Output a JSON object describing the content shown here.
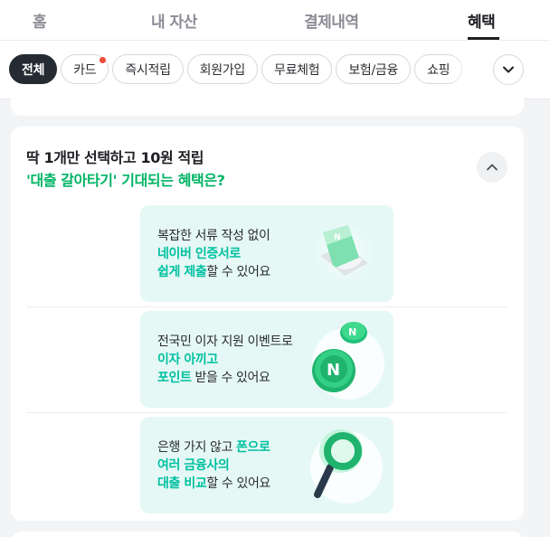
{
  "top_tabs": [
    {
      "label": "홈",
      "active": false
    },
    {
      "label": "내 자산",
      "active": false
    },
    {
      "label": "결제내역",
      "active": false
    },
    {
      "label": "혜택",
      "active": true
    }
  ],
  "chips": [
    {
      "label": "전체",
      "active": true,
      "new_dot": false
    },
    {
      "label": "카드",
      "active": false,
      "new_dot": true
    },
    {
      "label": "즉시적립",
      "active": false,
      "new_dot": false
    },
    {
      "label": "회원가입",
      "active": false,
      "new_dot": false
    },
    {
      "label": "무료체험",
      "active": false,
      "new_dot": false
    },
    {
      "label": "보험/금융",
      "active": false,
      "new_dot": false
    },
    {
      "label": "쇼핑",
      "active": false,
      "new_dot": false
    }
  ],
  "card": {
    "title": "딱 1개만 선택하고 10원 적립",
    "subtitle": "'대출 갈아타기' 기대되는 혜택은?",
    "benefits": [
      {
        "lines": [
          [
            {
              "t": "복잡한 서류 작성 없이",
              "hl": false
            }
          ],
          [
            {
              "t": "네이버 인증서로",
              "hl": true
            }
          ],
          [
            {
              "t": "쉽게 제출",
              "hl": true
            },
            {
              "t": "할 수 있어요",
              "hl": false
            }
          ]
        ],
        "icon": "document-certificate-icon"
      },
      {
        "lines": [
          [
            {
              "t": "전국민 이자 지원 이벤트로",
              "hl": false
            }
          ],
          [
            {
              "t": "이자 아끼고",
              "hl": true
            }
          ],
          [
            {
              "t": "포인트",
              "hl": true
            },
            {
              "t": " 받을 수 있어요",
              "hl": false
            }
          ]
        ],
        "icon": "naver-coin-icon"
      },
      {
        "lines": [
          [
            {
              "t": "은행 가지 않고 ",
              "hl": false
            },
            {
              "t": "폰으로",
              "hl": true
            }
          ],
          [
            {
              "t": "여러 금융사의",
              "hl": true
            }
          ],
          [
            {
              "t": "대출 비교",
              "hl": true
            },
            {
              "t": "할 수 있어요",
              "hl": false
            }
          ]
        ],
        "icon": "magnifier-icon"
      }
    ]
  },
  "colors": {
    "accent_green": "#00b464",
    "highlight_teal": "#00c0a0",
    "benefit_bg": "#e5f8f5",
    "notification_dot": "#f04c3c"
  }
}
